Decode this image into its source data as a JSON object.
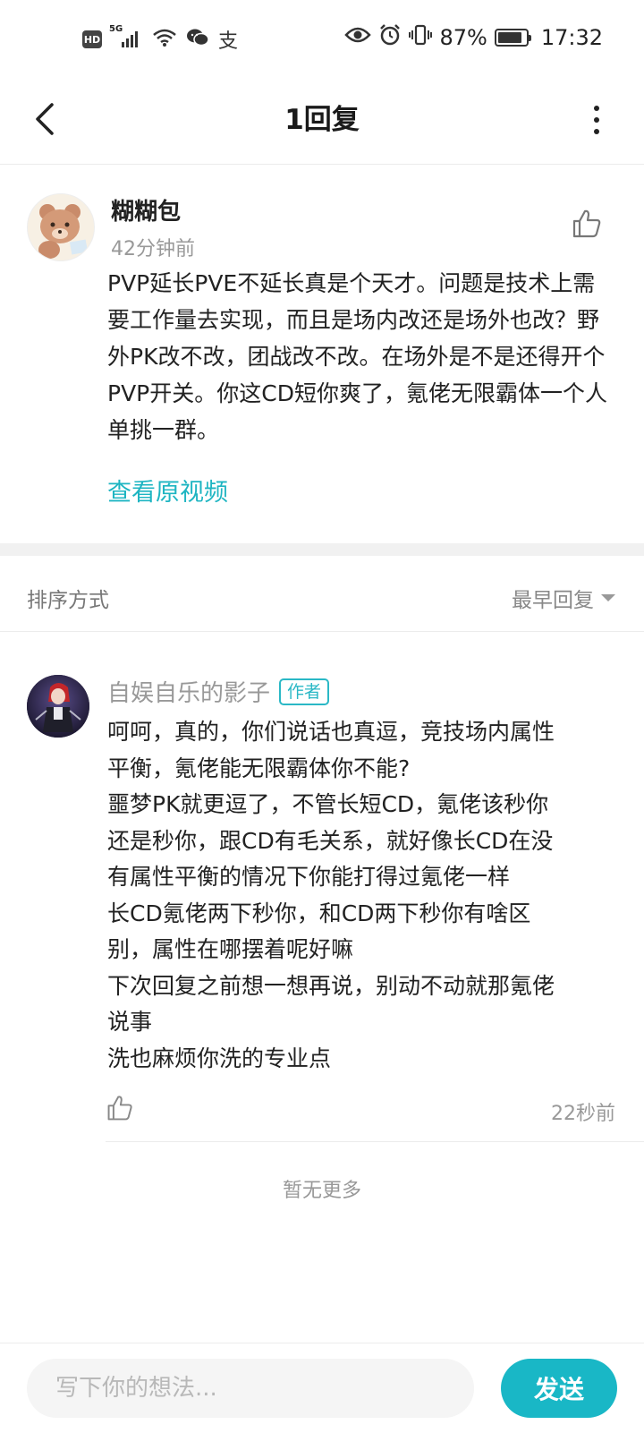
{
  "status_bar": {
    "hd": "HD",
    "net": "5G",
    "alipay_glyph": "支",
    "battery_percent": "87%",
    "battery_level": 0.87,
    "time": "17:32",
    "icons": [
      "signal-icon",
      "wifi-icon",
      "wechat-icon",
      "alipay-icon",
      "eye-icon",
      "alarm-icon",
      "vibrate-icon",
      "battery-icon"
    ]
  },
  "nav": {
    "title": "1回复"
  },
  "main_comment": {
    "author": "糊糊包",
    "time": "42分钟前",
    "text": "PVP延长PVE不延长真是个天才。问题是技术上需要工作量去实现，而且是场内改还是场外也改？野外PK改不改，团战改不改。在场外是不是还得开个PVP开关。你这CD短你爽了，氪佬无限霸体一个人单挑一群。",
    "link": "查看原视频"
  },
  "sort": {
    "label": "排序方式",
    "selected": "最早回复"
  },
  "reply": {
    "author": "自娱自乐的影子",
    "badge": "作者",
    "lines": [
      "呵呵，真的，你们说话也真逗，竞技场内属性",
      "平衡，氪佬能无限霸体你不能?",
      "噩梦PK就更逗了，不管长短CD，氪佬该秒你",
      "还是秒你，跟CD有毛关系，就好像长CD在没",
      "有属性平衡的情况下你能打得过氪佬一样",
      "长CD氪佬两下秒你，和CD两下秒你有啥区",
      "别，属性在哪摆着呢好嘛",
      "下次回复之前想一想再说，别动不动就那氪佬",
      "说事",
      "洗也麻烦你洗的专业点"
    ],
    "time": "22秒前"
  },
  "footer_note": "暂无更多",
  "input": {
    "placeholder": "写下你的想法..."
  },
  "send_label": "发送",
  "colors": {
    "accent": "#1eb5c2",
    "send_bg": "#19b7c6"
  }
}
